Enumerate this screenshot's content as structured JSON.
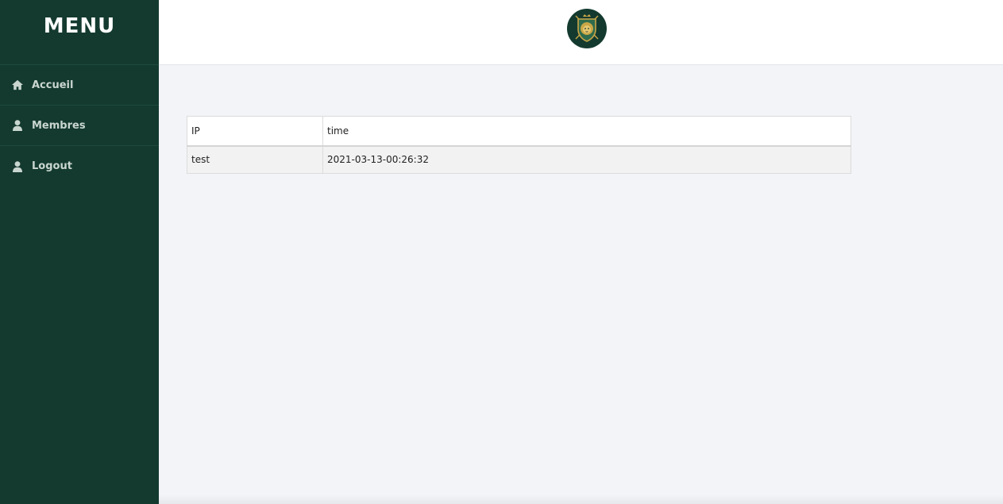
{
  "sidebar": {
    "title": "MENU",
    "items": [
      {
        "label": "Accueil",
        "icon": "home-icon"
      },
      {
        "label": "Membres",
        "icon": "user-icon"
      },
      {
        "label": "Logout",
        "icon": "user-icon"
      }
    ]
  },
  "header": {
    "logo": "lion-crest-logo"
  },
  "table": {
    "columns": [
      "IP",
      "time"
    ],
    "rows": [
      [
        "test",
        "2021-03-13-00:26:32"
      ]
    ]
  },
  "colors": {
    "sidebar_bg": "#143a2f",
    "page_bg": "#f3f4f8",
    "logo_gold": "#c9a646"
  }
}
